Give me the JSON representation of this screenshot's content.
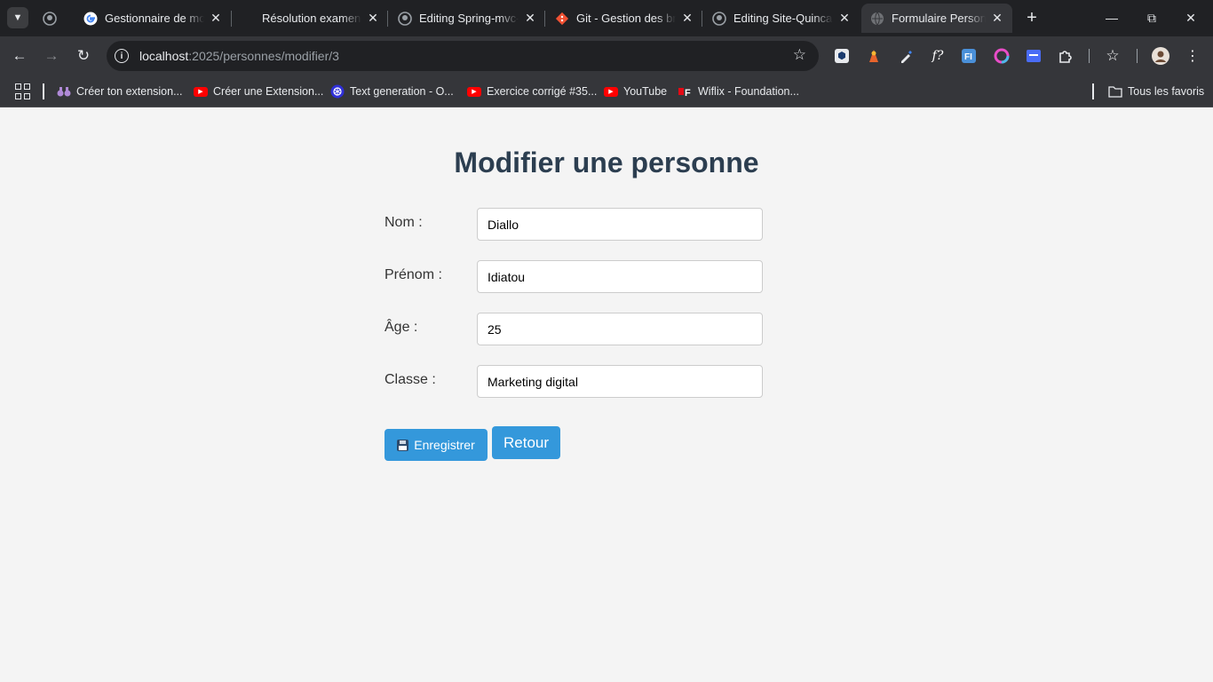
{
  "browser": {
    "tabs": [
      {
        "title": "",
        "favicon": "github-icon"
      },
      {
        "title": "Gestionnaire de mots de passe",
        "favicon": "google-icon"
      },
      {
        "title": "Résolution examens",
        "favicon": "blank-icon"
      },
      {
        "title": "Editing Spring-mvc-",
        "favicon": "github-icon"
      },
      {
        "title": "Git - Gestion des branches",
        "favicon": "git-icon"
      },
      {
        "title": "Editing Site-Quincaillerie",
        "favicon": "github-icon"
      },
      {
        "title": "Formulaire Personne",
        "favicon": "globe-icon",
        "active": true
      }
    ],
    "address": {
      "host": "localhost",
      "path": ":2025/personnes/modifier/3"
    },
    "bookmarks": [
      {
        "label": "Créer ton extension...",
        "icon": "binoculars-icon"
      },
      {
        "label": "Créer une Extension...",
        "icon": "youtube-icon"
      },
      {
        "label": "Text generation - O...",
        "icon": "openai-icon"
      },
      {
        "label": "Exercice corrigé #35...",
        "icon": "youtube-icon"
      },
      {
        "label": "YouTube",
        "icon": "youtube-icon"
      },
      {
        "label": "Wiflix - Foundation...",
        "icon": "wiflix-icon"
      }
    ],
    "all_bookmarks_label": "Tous les favoris",
    "colors": {
      "chrome_dark": "#202124",
      "toolbar": "#35363a",
      "accent": "#3498db",
      "title": "#2c3e50"
    }
  },
  "form": {
    "title": "Modifier une personne",
    "fields": [
      {
        "label": "Nom :",
        "value": "Diallo"
      },
      {
        "label": "Prénom :",
        "value": "Idiatou"
      },
      {
        "label": "Âge :",
        "value": "25"
      },
      {
        "label": "Classe :",
        "value": "Marketing digital"
      }
    ],
    "save_label": "Enregistrer",
    "back_label": "Retour"
  }
}
